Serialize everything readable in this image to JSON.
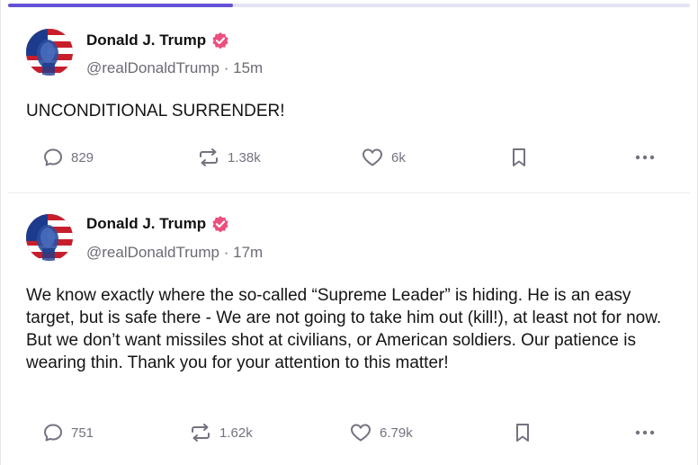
{
  "progress": {
    "fraction": 0.33,
    "fill_color": "#6352d6",
    "track_color": "#e3e3f4"
  },
  "posts": [
    {
      "author": {
        "name": "Donald J. Trump",
        "verified": true,
        "avatar": "flag-portrait"
      },
      "handle": "@realDonaldTrump",
      "separator": "·",
      "time": "15m",
      "text": "UNCONDITIONAL SURRENDER!",
      "actions": {
        "replies": "829",
        "reposts": "1.38k",
        "likes": "6k"
      }
    },
    {
      "author": {
        "name": "Donald J. Trump",
        "verified": true,
        "avatar": "flag-portrait"
      },
      "handle": "@realDonaldTrump",
      "separator": "·",
      "time": "17m",
      "text": "We know exactly where the so-called “Supreme Leader” is hiding. He is an easy target, but is safe there - We are not going to take him out (kill!), at least not for now. But we don’t want missiles shot at civilians, or American soldiers. Our patience is wearing thin. Thank you for your attention to this matter!",
      "actions": {
        "replies": "751",
        "reposts": "1.62k",
        "likes": "6.79k"
      }
    }
  ],
  "icons": {
    "reply": "comment-bubble-icon",
    "repost": "repost-arrows-icon",
    "like": "heart-icon",
    "bookmark": "bookmark-icon",
    "more": "more-dots-icon",
    "verified": "verified-badge-icon"
  },
  "colors": {
    "verified": "#ec4f7e",
    "muted": "#737380",
    "text": "#141414"
  }
}
